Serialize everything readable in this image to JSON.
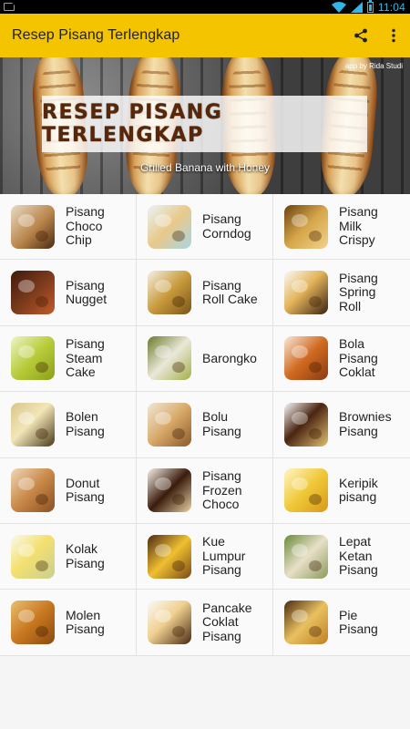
{
  "status_bar": {
    "time": "11:04"
  },
  "app_bar": {
    "title": "Resep Pisang Terlengkap"
  },
  "banner": {
    "credit": "app by Rida Studi",
    "title": "RESEP PISANG TERLENGKAP",
    "caption": "Grilled Banana with Honey"
  },
  "colors": {
    "app_bar": "#f5c400",
    "status_accent": "#33b5e5",
    "banner_title": "#5a2608"
  },
  "icons": {
    "share": "share-icon",
    "overflow": "more-vert-icon"
  },
  "recipes": [
    {
      "label": "Pisang Choco Chip",
      "bg": "linear-gradient(135deg,#e8dcc4,#b8844a 55%,#4b2a12)"
    },
    {
      "label": "Pisang Corndog",
      "bg": "linear-gradient(135deg,#e9f4f7,#e8c98a 50%,#a7d6e2)"
    },
    {
      "label": "Pisang Milk Crispy",
      "bg": "linear-gradient(135deg,#6b4212,#d6a64a 50%,#f0d28a)"
    },
    {
      "label": "Pisang Nugget",
      "bg": "linear-gradient(135deg,#3f1a0c,#7a3a1c 50%,#c45a2a)"
    },
    {
      "label": "Pisang Roll Cake",
      "bg": "linear-gradient(135deg,#f4f0e6,#c99b3c 50%,#7a5418)"
    },
    {
      "label": "Pisang Spring Roll",
      "bg": "linear-gradient(135deg,#fafafa,#e4b45a 45%,#3a2212)"
    },
    {
      "label": "Pisang Steam Cake",
      "bg": "linear-gradient(135deg,#eef4c8,#b8cc3a 50%,#8aa018)"
    },
    {
      "label": "Barongko",
      "bg": "linear-gradient(135deg,#6a7a2a,#eae8d8 50%,#a4b04a)"
    },
    {
      "label": "Bola Pisang Coklat",
      "bg": "linear-gradient(135deg,#f6e9dc,#d06a20 50%,#8a3a10)"
    },
    {
      "label": "Bolen Pisang",
      "bg": "linear-gradient(135deg,#d9c58a,#f2e6b8 45%,#4a3a1a)"
    },
    {
      "label": "Bolu Pisang",
      "bg": "linear-gradient(135deg,#f0e8d8,#d8a868 50%,#8a5a2a)"
    },
    {
      "label": "Brownies Pisang",
      "bg": "linear-gradient(135deg,#fafafa,#4a2412 45%,#e0c070)"
    },
    {
      "label": "Donut Pisang",
      "bg": "linear-gradient(135deg,#f0d8b8,#c88848 50%,#8a5020)"
    },
    {
      "label": "Pisang Frozen Choco",
      "bg": "linear-gradient(135deg,#f6f0e8,#3a1c0c 50%,#e8d0a0)"
    },
    {
      "label": "Keripik pisang",
      "bg": "linear-gradient(135deg,#fff6c8,#f0c838 50%,#d89a18)"
    },
    {
      "label": "Kolak Pisang",
      "bg": "linear-gradient(135deg,#fafaf0,#f4e070 45%,#c8d090)"
    },
    {
      "label": "Kue Lumpur Pisang",
      "bg": "linear-gradient(135deg,#4a2a14,#f0c030 50%,#7a4a18)"
    },
    {
      "label": "Lepat Ketan Pisang",
      "bg": "linear-gradient(135deg,#6a8a3a,#e8e0c8 50%,#8a9a5a)"
    },
    {
      "label": "Molen Pisang",
      "bg": "linear-gradient(135deg,#e8c070,#c87820 50%,#8a4a10)"
    },
    {
      "label": "Pancake Coklat Pisang",
      "bg": "linear-gradient(135deg,#fafafa,#f0d090 45%,#4a2a12)"
    },
    {
      "label": "Pie Pisang",
      "bg": "linear-gradient(135deg,#4a2a12,#e8c060 50%,#c08020)"
    }
  ]
}
